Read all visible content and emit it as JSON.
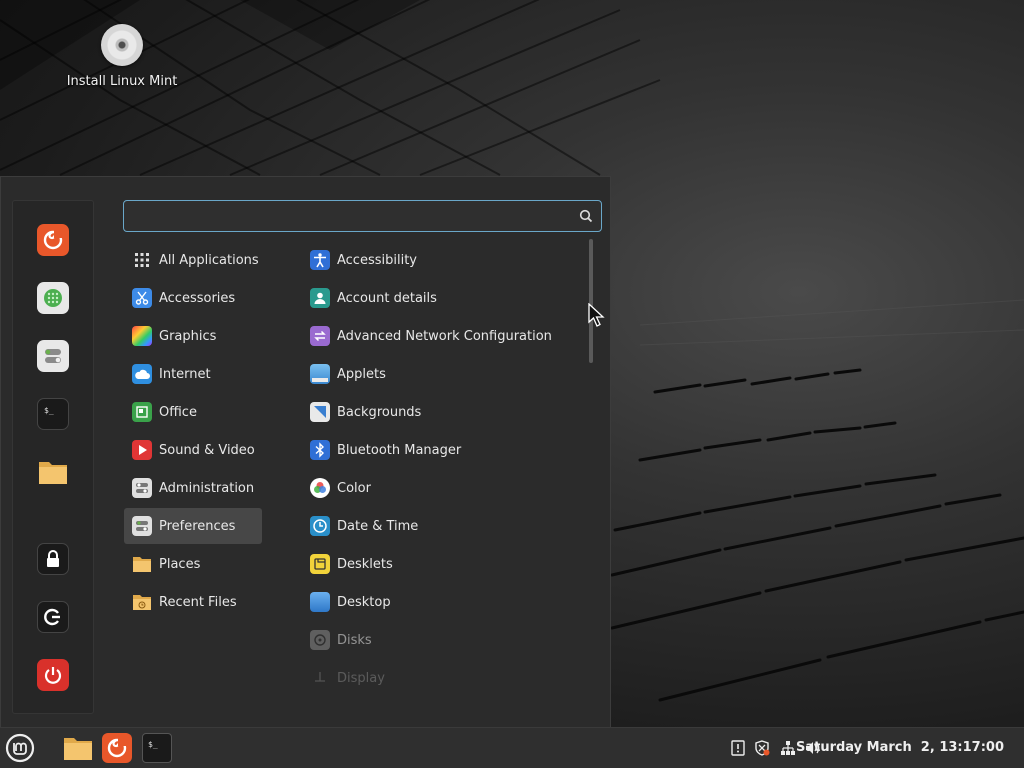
{
  "desktop": {
    "icons": [
      {
        "label": "Install Linux Mint",
        "icon": "disc-icon"
      }
    ]
  },
  "menu": {
    "search": {
      "value": "",
      "placeholder": ""
    },
    "favorites": [
      {
        "name": "firefox",
        "icon": "firefox-icon"
      },
      {
        "name": "software-manager",
        "icon": "software-manager-icon"
      },
      {
        "name": "system-settings",
        "icon": "settings-toggles-icon"
      },
      {
        "name": "terminal",
        "icon": "terminal-icon"
      },
      {
        "name": "files",
        "icon": "folder-icon"
      }
    ],
    "session": [
      {
        "name": "lock-screen",
        "icon": "lock-icon"
      },
      {
        "name": "log-out",
        "icon": "logout-icon"
      },
      {
        "name": "quit",
        "icon": "power-icon"
      }
    ],
    "categories": [
      {
        "label": "All Applications",
        "icon": "grid-icon"
      },
      {
        "label": "Accessories",
        "icon": "scissors-icon"
      },
      {
        "label": "Graphics",
        "icon": "graphics-icon"
      },
      {
        "label": "Internet",
        "icon": "cloud-icon"
      },
      {
        "label": "Office",
        "icon": "office-icon"
      },
      {
        "label": "Sound & Video",
        "icon": "play-icon"
      },
      {
        "label": "Administration",
        "icon": "admin-icon"
      },
      {
        "label": "Preferences",
        "icon": "preferences-icon",
        "selected": true
      },
      {
        "label": "Places",
        "icon": "folder-icon"
      },
      {
        "label": "Recent Files",
        "icon": "recent-folder-icon"
      }
    ],
    "apps": [
      {
        "label": "Accessibility",
        "icon": "accessibility-icon"
      },
      {
        "label": "Account details",
        "icon": "account-icon"
      },
      {
        "label": "Advanced Network Configuration",
        "icon": "network-config-icon"
      },
      {
        "label": "Applets",
        "icon": "applets-icon"
      },
      {
        "label": "Backgrounds",
        "icon": "backgrounds-icon"
      },
      {
        "label": "Bluetooth Manager",
        "icon": "bluetooth-icon"
      },
      {
        "label": "Color",
        "icon": "color-icon"
      },
      {
        "label": "Date & Time",
        "icon": "clock-icon"
      },
      {
        "label": "Desklets",
        "icon": "desklets-icon"
      },
      {
        "label": "Desktop",
        "icon": "desktop-icon"
      },
      {
        "label": "Disks",
        "icon": "disks-icon"
      },
      {
        "label": "Display",
        "icon": "display-icon"
      }
    ]
  },
  "panel": {
    "launchers": [
      {
        "name": "menu",
        "icon": "mint-logo-icon"
      },
      {
        "name": "files",
        "icon": "folder-icon"
      },
      {
        "name": "firefox",
        "icon": "firefox-icon"
      },
      {
        "name": "terminal",
        "icon": "terminal-icon"
      }
    ],
    "tray": [
      {
        "name": "notifications",
        "icon": "notification-icon"
      },
      {
        "name": "update-manager",
        "icon": "shield-icon"
      },
      {
        "name": "network",
        "icon": "network-icon"
      },
      {
        "name": "volume",
        "icon": "volume-icon"
      }
    ],
    "clock": "Saturday March  2, 13:17:00"
  },
  "colors": {
    "accent": "#6aa7c9",
    "menu_bg": "#2b2b2b",
    "panel_bg": "#2f2f2f",
    "selected_bg": "#474747"
  }
}
